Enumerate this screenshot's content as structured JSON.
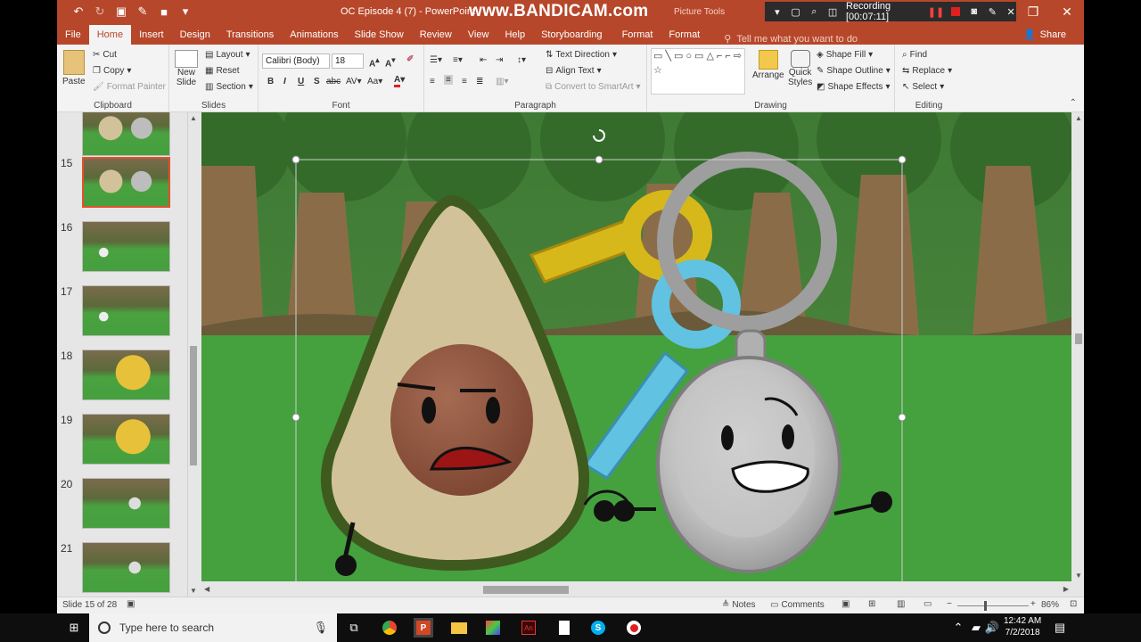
{
  "titlebar": {
    "doc_title": "OC Episode 4 (7)  -  PowerPoint",
    "watermark": "www.BANDICAM.com",
    "context_title": "Picture Tools",
    "recording_label": "Recording [00:07:11]"
  },
  "tabs": [
    "File",
    "Home",
    "Insert",
    "Design",
    "Transitions",
    "Animations",
    "Slide Show",
    "Review",
    "View",
    "Help",
    "Storyboarding",
    "Format",
    "Format"
  ],
  "active_tab": "Home",
  "tell_me": "Tell me what you want to do",
  "share_label": "Share",
  "ribbon": {
    "clipboard": {
      "paste": "Paste",
      "cut": "Cut",
      "copy": "Copy",
      "format_painter": "Format Painter",
      "label": "Clipboard"
    },
    "slides": {
      "new_slide": "New",
      "new_slide2": "Slide",
      "layout": "Layout",
      "reset": "Reset",
      "section": "Section",
      "label": "Slides"
    },
    "font": {
      "family": "Calibri (Body)",
      "size": "18",
      "label": "Font"
    },
    "paragraph": {
      "text_direction": "Text Direction",
      "align_text": "Align Text",
      "convert_smartart": "Convert to SmartArt",
      "label": "Paragraph"
    },
    "drawing": {
      "arrange": "Arrange",
      "quick_styles": "Quick",
      "quick_styles2": "Styles",
      "shape_fill": "Shape Fill",
      "shape_outline": "Shape Outline",
      "shape_effects": "Shape Effects",
      "label": "Drawing"
    },
    "editing": {
      "find": "Find",
      "replace": "Replace",
      "select": "Select",
      "label": "Editing"
    }
  },
  "thumbnails": [
    {
      "num": "",
      "selected": false
    },
    {
      "num": "15",
      "selected": true
    },
    {
      "num": "16",
      "selected": false
    },
    {
      "num": "17",
      "selected": false
    },
    {
      "num": "18",
      "selected": false
    },
    {
      "num": "19",
      "selected": false
    },
    {
      "num": "20",
      "selected": false
    },
    {
      "num": "21",
      "selected": false
    }
  ],
  "status": {
    "slide_info": "Slide 15 of 28",
    "notes": "Notes",
    "comments": "Comments",
    "zoom": "86%"
  },
  "taskbar": {
    "search_placeholder": "Type here to search",
    "time": "12:42 AM",
    "date": "7/2/2018"
  },
  "colors": {
    "accent": "#b7472a",
    "selection": "#e0522c"
  }
}
